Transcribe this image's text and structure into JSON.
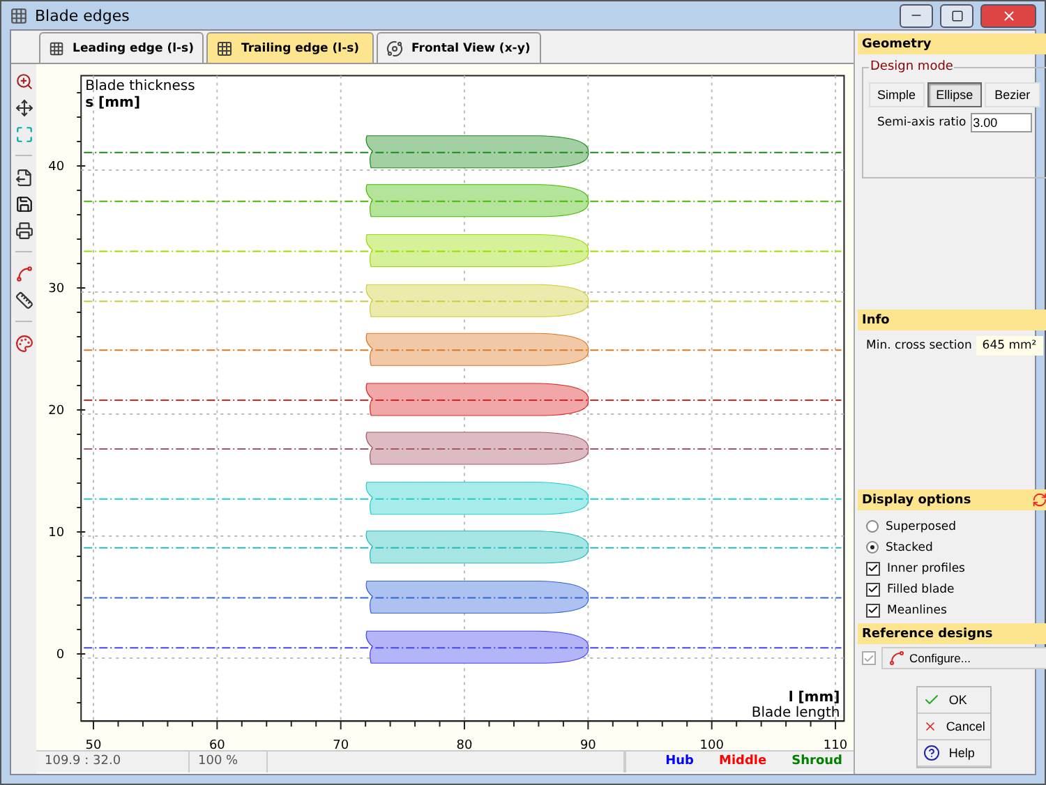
{
  "window": {
    "title": "Blade edges"
  },
  "tabs": [
    {
      "label": "Leading edge (l-s)",
      "selected": false,
      "kind": "plot"
    },
    {
      "label": "Trailing edge (l-s)",
      "selected": true,
      "kind": "plot"
    },
    {
      "label": "Frontal View (x-y)",
      "selected": false,
      "kind": "frontal"
    }
  ],
  "chart": {
    "chart_data": {
      "type": "line",
      "grid": true,
      "title": "Blade thickness",
      "ylabel": "s [mm]",
      "xlabel": "l [mm]",
      "annotations": [
        {
          "text": "Blade length"
        }
      ],
      "x": [
        49,
        110.7
      ],
      "xlim": [
        49,
        110.7
      ],
      "ylim": [
        -5.5,
        47.4
      ],
      "xticks": [
        50,
        60,
        70,
        80,
        90,
        100,
        110
      ],
      "yticks": [
        0,
        10,
        20,
        30,
        40
      ],
      "series": [
        {
          "color": "#1a8a1a",
          "line_style": "dashdot",
          "values": [
            41.1,
            41.1
          ]
        },
        {
          "color": "#44bb00",
          "line_style": "dashdot",
          "values": [
            37.1,
            37.1
          ]
        },
        {
          "color": "#99dd00",
          "line_style": "dashdot",
          "values": [
            33.0,
            33.0
          ]
        },
        {
          "color": "#cccc33",
          "line_style": "dashdot",
          "values": [
            28.9,
            28.9
          ]
        },
        {
          "color": "#dd7722",
          "line_style": "dashdot",
          "values": [
            24.9,
            24.9
          ]
        },
        {
          "color": "#dd2222",
          "line_style": "dashdot",
          "values": [
            20.8,
            20.8
          ]
        },
        {
          "color": "#aa5566",
          "line_style": "dashdot",
          "values": [
            16.8,
            16.8
          ]
        },
        {
          "color": "#22cccc",
          "line_style": "dashdot",
          "values": [
            12.7,
            12.7
          ]
        },
        {
          "color": "#22bbbb",
          "line_style": "dashdot",
          "values": [
            8.7,
            8.7
          ]
        },
        {
          "color": "#3366dd",
          "line_style": "dashdot",
          "values": [
            4.6,
            4.6
          ]
        },
        {
          "color": "#4444ee",
          "line_style": "dashdot",
          "values": [
            0.5,
            0.5
          ]
        }
      ]
    }
  },
  "status_bar": {
    "position": "109.9 : 32.0",
    "zoom": "100 %",
    "legend": [
      {
        "label": "Hub",
        "color": "#0000ff"
      },
      {
        "label": "Middle",
        "color": "#ff0000"
      },
      {
        "label": "Shroud",
        "color": "#008000"
      }
    ]
  },
  "geometry": {
    "title": "Geometry",
    "group": "Design mode",
    "modes": [
      {
        "label": "Simple",
        "selected": false
      },
      {
        "label": "Ellipse",
        "selected": true
      },
      {
        "label": "Bezier",
        "selected": false
      }
    ],
    "ratio_label": "Semi-axis ratio",
    "ratio_value": "3.00"
  },
  "info": {
    "title": "Info",
    "label": "Min. cross section",
    "value": "645 mm²"
  },
  "display_options": {
    "title": "Display options",
    "radios": [
      {
        "label": "Superposed",
        "selected": false
      },
      {
        "label": "Stacked",
        "selected": true
      }
    ],
    "checks": [
      {
        "label": "Inner profiles",
        "checked": true
      },
      {
        "label": "Filled blade",
        "checked": true
      },
      {
        "label": "Meanlines",
        "checked": true
      }
    ]
  },
  "reference_designs": {
    "title": "Reference designs",
    "enabled": {
      "checked": true,
      "disabled": true
    },
    "button": "Configure..."
  },
  "buttons": [
    {
      "label": "OK",
      "kind": "ok"
    },
    {
      "label": "Cancel",
      "kind": "cancel"
    },
    {
      "label": "Help",
      "kind": "help"
    }
  ]
}
